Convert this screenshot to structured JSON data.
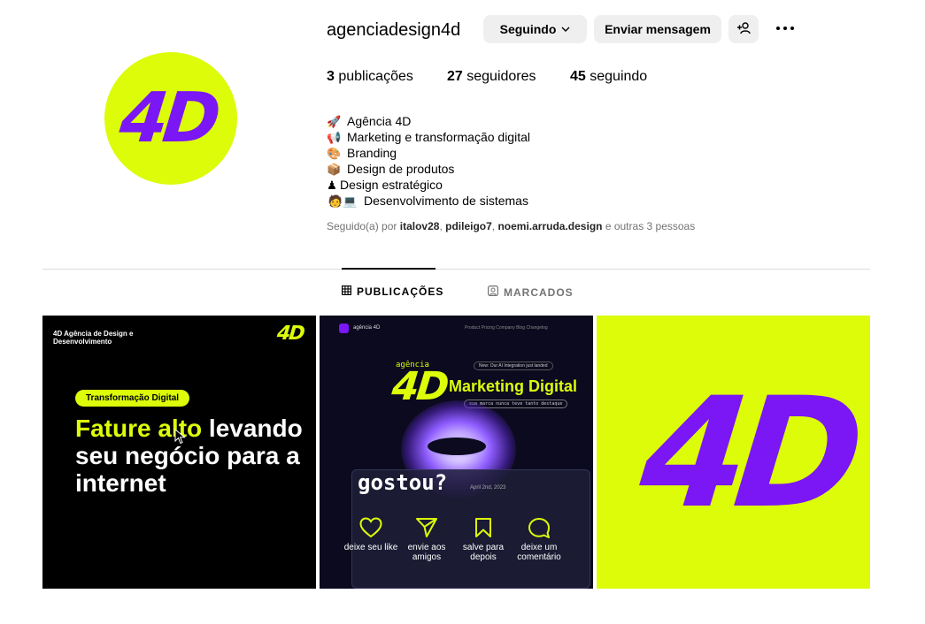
{
  "profile": {
    "username": "agenciadesign4d",
    "avatar_text": "4D",
    "follow_label": "Seguindo",
    "message_label": "Enviar mensagem",
    "stats": {
      "posts_count": "3",
      "posts_label": "publicações",
      "followers_count": "27",
      "followers_label": "seguidores",
      "following_count": "45",
      "following_label": "seguindo"
    },
    "bio": [
      {
        "icon": "rocket-icon",
        "glyph": "🚀",
        "text": "Agência 4D"
      },
      {
        "icon": "megaphone-icon",
        "glyph": "📢",
        "text": "Marketing e transformação digital"
      },
      {
        "icon": "palette-icon",
        "glyph": "🎨",
        "text": "Branding"
      },
      {
        "icon": "package-icon",
        "glyph": "📦",
        "text": "Design de produtos"
      },
      {
        "icon": "chess-pawn-icon",
        "glyph": "♟",
        "text": "Design estratégico"
      },
      {
        "icon": "technologist-icon",
        "glyph": "🧑💻",
        "text": "Desenvolvimento de sistemas"
      }
    ],
    "followed_by": {
      "prefix": "Seguido(a) por",
      "users": [
        "italov28",
        "pdileigo7",
        "noemi.arruda.design"
      ],
      "suffix": "e outras 3 pessoas"
    }
  },
  "tabs": {
    "posts": "PUBLICAÇÕES",
    "tagged": "MARCADOS"
  },
  "posts": [
    {
      "brand": "4D Agência de Design e Desenvolvimento",
      "logo": "4D",
      "pill": "Transformação Digital",
      "headline_highlight": "Fature alto",
      "headline_rest": "levando seu negócio para a internet"
    },
    {
      "site": "agência 4D",
      "nav_links": "Product   Pricing   Company   Blog   Changelog",
      "agencia": "agência",
      "badge": "New: Our AI Integration just landed",
      "logo": "4D",
      "title": "Marketing Digital",
      "tagline": "sua marca nunca teve tanto destaque",
      "date": "April 2nd, 2023",
      "gostou": "gostou?",
      "actions": [
        {
          "icon": "heart-icon",
          "label": "deixe seu like"
        },
        {
          "icon": "send-icon",
          "label": "envie aos amigos"
        },
        {
          "icon": "bookmark-icon",
          "label": "salve para depois"
        },
        {
          "icon": "comment-icon",
          "label": "deixe um comentário"
        }
      ]
    },
    {
      "logo": "4D"
    }
  ],
  "colors": {
    "lime": "#dcfc0a",
    "purple": "#7b16f5",
    "button_bg": "#efefef",
    "muted": "#737373"
  }
}
